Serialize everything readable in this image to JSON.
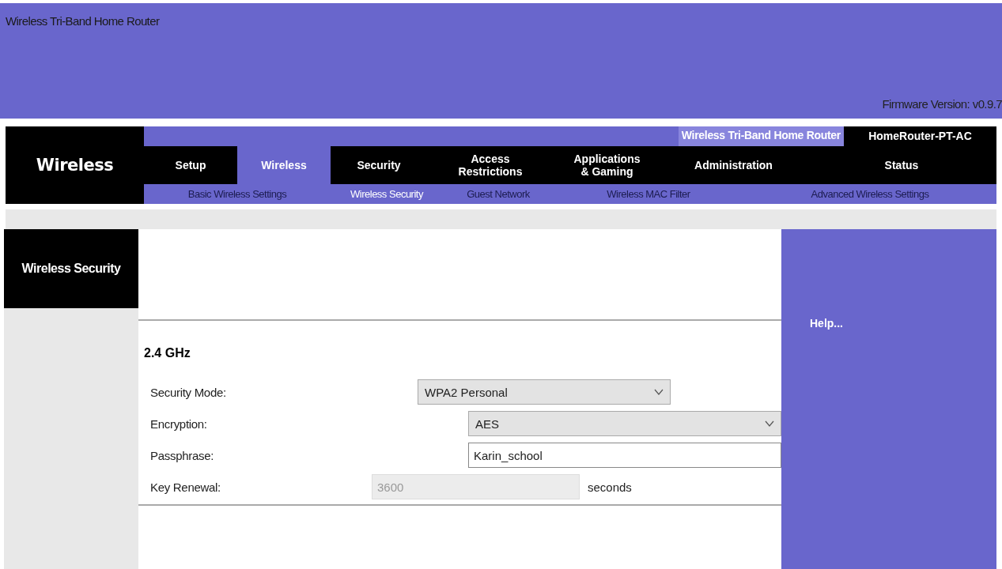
{
  "header": {
    "title": "Wireless Tri-Band Home Router",
    "firmware": "Firmware Version: v0.9.7"
  },
  "nav": {
    "section_title": "Wireless",
    "product_name": "Wireless Tri-Band Home Router",
    "model_name": "HomeRouter-PT-AC",
    "tabs": [
      {
        "label": "Setup",
        "selected": false
      },
      {
        "label": "Wireless",
        "selected": true
      },
      {
        "label": "Security",
        "selected": false
      },
      {
        "label": "Access Restrictions",
        "selected": false
      },
      {
        "label": "Applications & Gaming",
        "selected": false
      },
      {
        "label": "Administration",
        "selected": false
      },
      {
        "label": "Status",
        "selected": false
      }
    ],
    "subtabs": [
      {
        "label": "Basic Wireless Settings",
        "selected": false
      },
      {
        "label": "Wireless Security",
        "selected": true
      },
      {
        "label": "Guest Network",
        "selected": false
      },
      {
        "label": "Wireless MAC Filter",
        "selected": false
      },
      {
        "label": "Advanced Wireless Settings",
        "selected": false
      }
    ]
  },
  "sidebar": {
    "title": "Wireless Security"
  },
  "form": {
    "band": "2.4 GHz",
    "fields": [
      {
        "kind": "select",
        "label": "Security Mode:",
        "value": "WPA2 Personal",
        "disabled": false
      },
      {
        "kind": "select",
        "label": "Encryption:",
        "value": "AES",
        "disabled": false
      },
      {
        "kind": "text",
        "label": "Passphrase:",
        "value": "Karin_school",
        "disabled": false
      },
      {
        "kind": "text",
        "label": "Key Renewal:",
        "value": "3600",
        "disabled": true,
        "unit": "seconds"
      }
    ]
  },
  "help": {
    "label": "Help..."
  }
}
